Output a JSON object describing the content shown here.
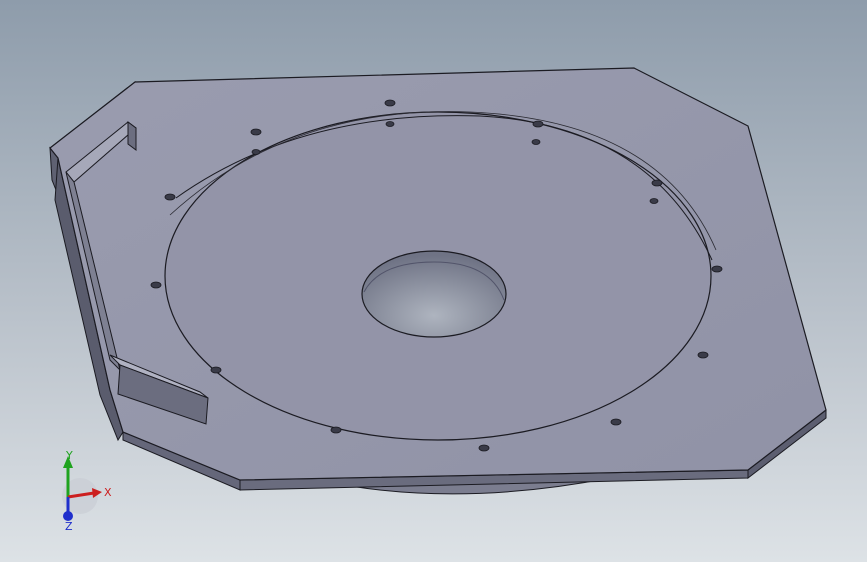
{
  "viewport": {
    "background_top": "#8e9cab",
    "background_bottom": "#dde2e6",
    "model_color": "#9496aa",
    "edge_color": "#1b1b22"
  },
  "triad": {
    "x_label": "X",
    "y_label": "Y",
    "z_label": "Z",
    "x_color": "#cc1f1f",
    "y_color": "#1fa31f",
    "z_color": "#1f2fcc"
  }
}
